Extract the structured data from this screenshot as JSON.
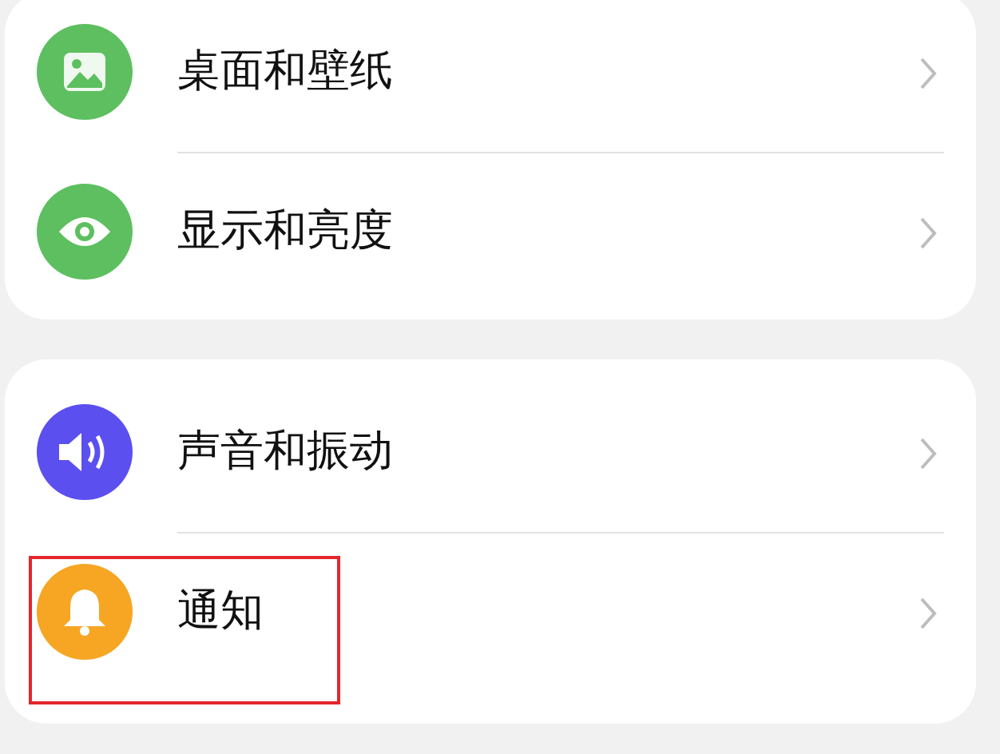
{
  "groups": [
    {
      "items": [
        {
          "label": "桌面和壁纸",
          "kind": "picture",
          "color": "#5dbf5f",
          "highlighted": false
        },
        {
          "label": "显示和亮度",
          "kind": "eye",
          "color": "#5dbf5f",
          "highlighted": false
        }
      ]
    },
    {
      "items": [
        {
          "label": "声音和振动",
          "kind": "speaker",
          "color": "#5b4ff0",
          "highlighted": false
        },
        {
          "label": "通知",
          "kind": "bell",
          "color": "#f6a623",
          "highlighted": true
        }
      ]
    }
  ]
}
